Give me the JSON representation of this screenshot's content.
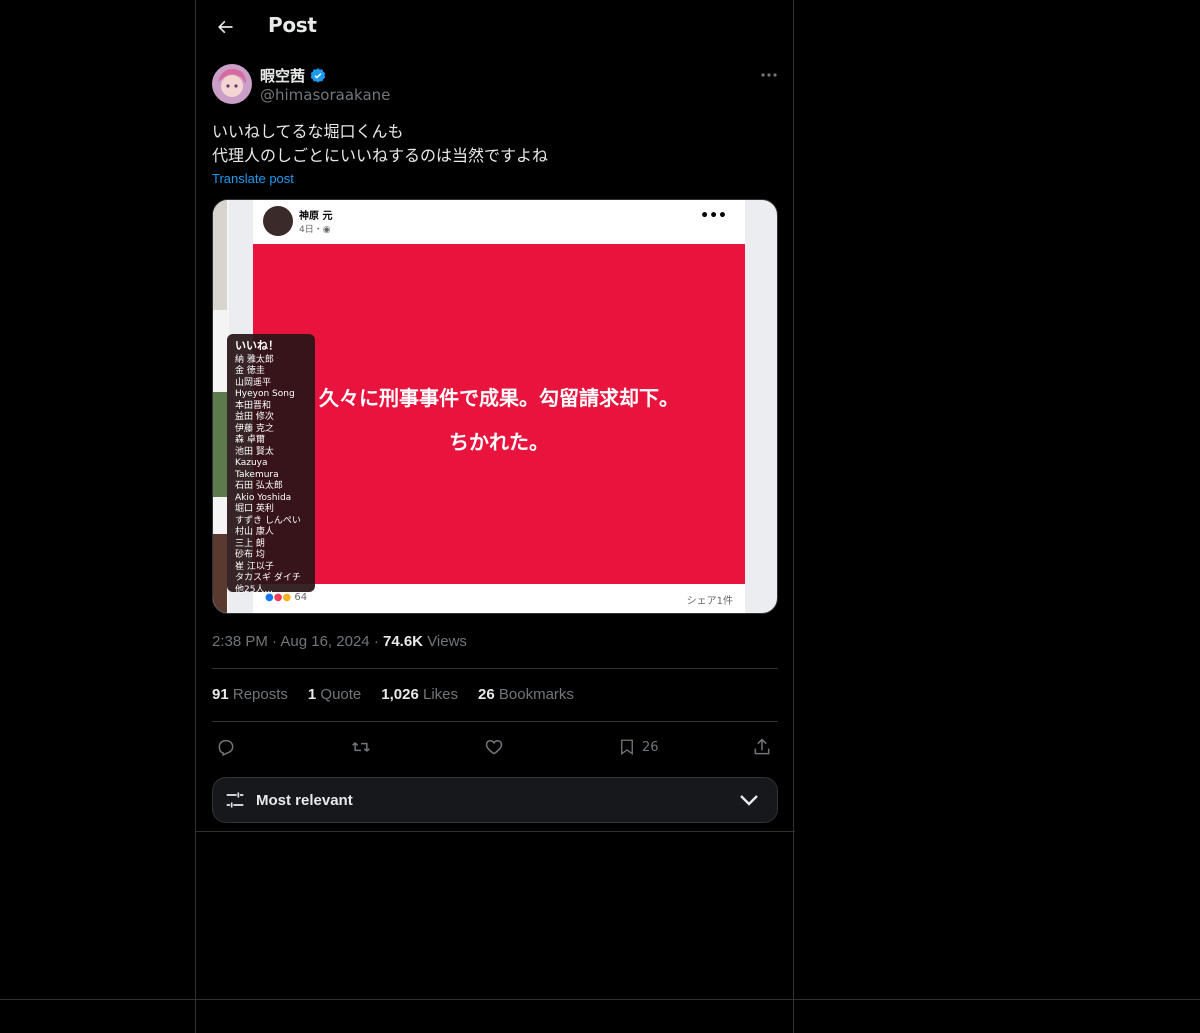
{
  "header": {
    "title": "Post"
  },
  "author": {
    "display_name": "暇空茜",
    "handle": "@himasoraakane",
    "verified": true
  },
  "post": {
    "lines": [
      "いいねしてるな堀口くんも",
      "代理人のしごとにいいねするのは当然ですよね"
    ],
    "translate_label": "Translate post"
  },
  "media": {
    "fb_name": "神原 元",
    "fb_time": "4日・",
    "fb_more": "•••",
    "red_lines": [
      "久々に刑事事件で成果。勾留請求却下。",
      "ちかれた。"
    ],
    "reactions_count": "64",
    "share_label": "シェア1件",
    "likes_title": "いいね！",
    "likes_names": [
      "納 雅太郎",
      "金 徳圭",
      "山岡遥平",
      "Hyeyon Song",
      "本田晋和",
      "益田 修次",
      "伊藤 克之",
      "森 卓爾",
      "池田 賢太",
      "Kazuya Takemura",
      "石田 弘太郎",
      "Akio Yoshida",
      "堀口 英利",
      "すずき しんぺい",
      "村山 康人",
      "三上 朗",
      "砂布 均",
      "崔 江以子",
      "タカスギ ダイチ",
      "他25人..."
    ]
  },
  "meta": {
    "time": "2:38 PM",
    "dot1": "·",
    "date": "Aug 16, 2024",
    "dot2": "·",
    "views_count": "74.6K",
    "views_label": "Views"
  },
  "stats": [
    {
      "count": "91",
      "label": "Reposts"
    },
    {
      "count": "1",
      "label": "Quote"
    },
    {
      "count": "1,026",
      "label": "Likes"
    },
    {
      "count": "26",
      "label": "Bookmarks"
    }
  ],
  "actions": {
    "reply_icon": "reply-icon",
    "repost_icon": "repost-icon",
    "like_icon": "heart-icon",
    "bookmark_count": "26",
    "share_icon": "share-icon"
  },
  "sort": {
    "label": "Most relevant"
  },
  "colors": {
    "accent": "#1d9bf0",
    "fb_red": "#e8143d"
  }
}
